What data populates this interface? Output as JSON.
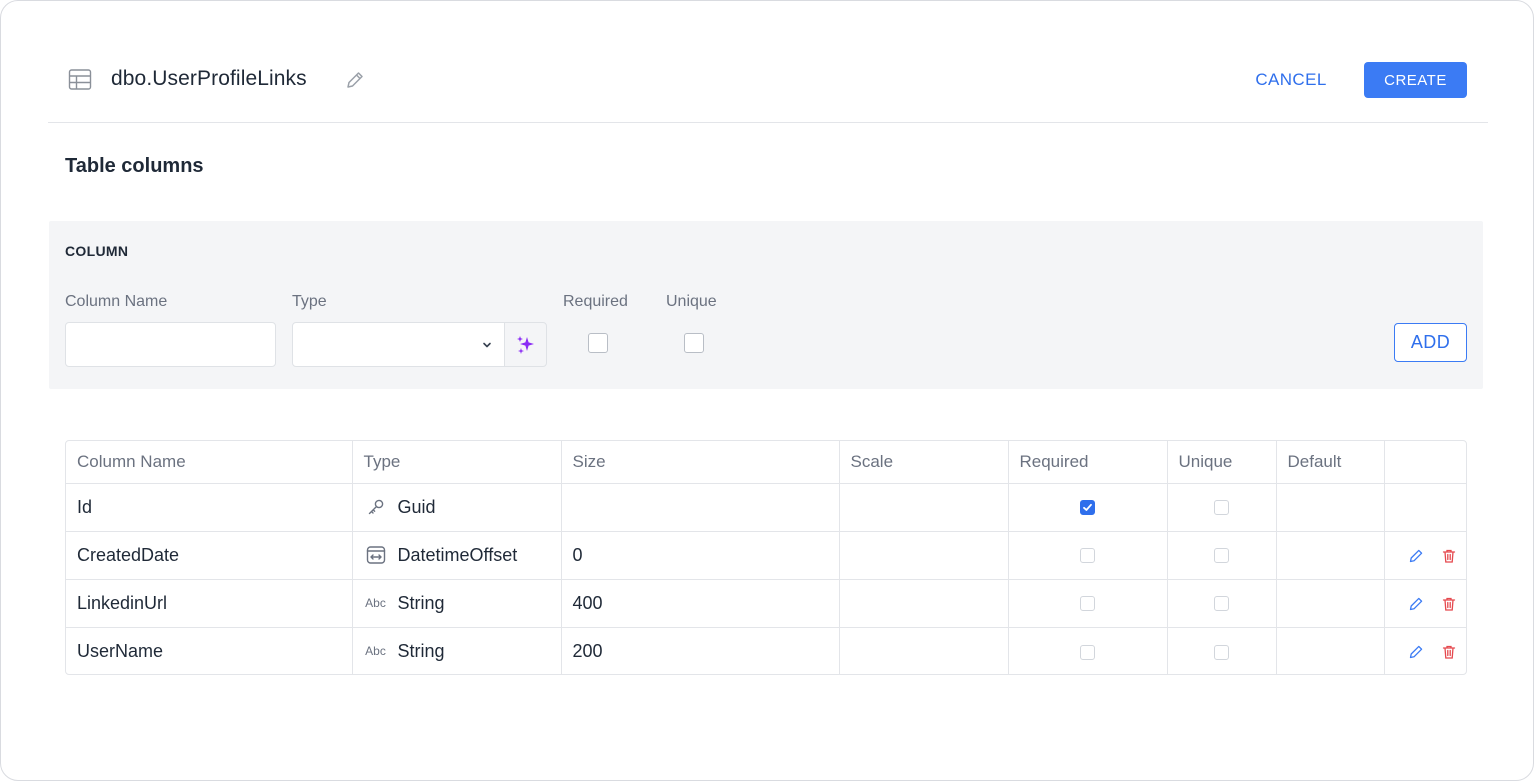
{
  "header": {
    "title": "dbo.UserProfileLinks",
    "cancel_label": "CANCEL",
    "create_label": "CREATE",
    "icons": {
      "table": "table-icon",
      "edit": "pencil-icon"
    }
  },
  "section_title": "Table columns",
  "form": {
    "panel_title": "COLUMN",
    "column_name_label": "Column Name",
    "column_name_value": "",
    "type_label": "Type",
    "type_value": "",
    "required_label": "Required",
    "required_checked": false,
    "unique_label": "Unique",
    "unique_checked": false,
    "add_label": "ADD",
    "ai_icon": "sparkles-icon"
  },
  "table": {
    "headers": [
      "Column Name",
      "Type",
      "Size",
      "Scale",
      "Required",
      "Unique",
      "Default",
      ""
    ],
    "rows": [
      {
        "name": "Id",
        "type_icon": "key-icon",
        "type": "Guid",
        "size": "",
        "scale": "",
        "required": true,
        "unique": false,
        "default": "",
        "editable": false
      },
      {
        "name": "CreatedDate",
        "type_icon": "datetime-icon",
        "type": "DatetimeOffset",
        "size": "0",
        "scale": "",
        "required": false,
        "unique": false,
        "default": "",
        "editable": true
      },
      {
        "name": "LinkedinUrl",
        "type_icon": "Abc",
        "type": "String",
        "size": "400",
        "scale": "",
        "required": false,
        "unique": false,
        "default": "",
        "editable": true
      },
      {
        "name": "UserName",
        "type_icon": "Abc",
        "type": "String",
        "size": "200",
        "scale": "",
        "required": false,
        "unique": false,
        "default": "",
        "editable": true
      }
    ]
  },
  "colors": {
    "accent": "#3b7bf4",
    "danger": "#e5484d",
    "ai": "#8b2cf5"
  }
}
